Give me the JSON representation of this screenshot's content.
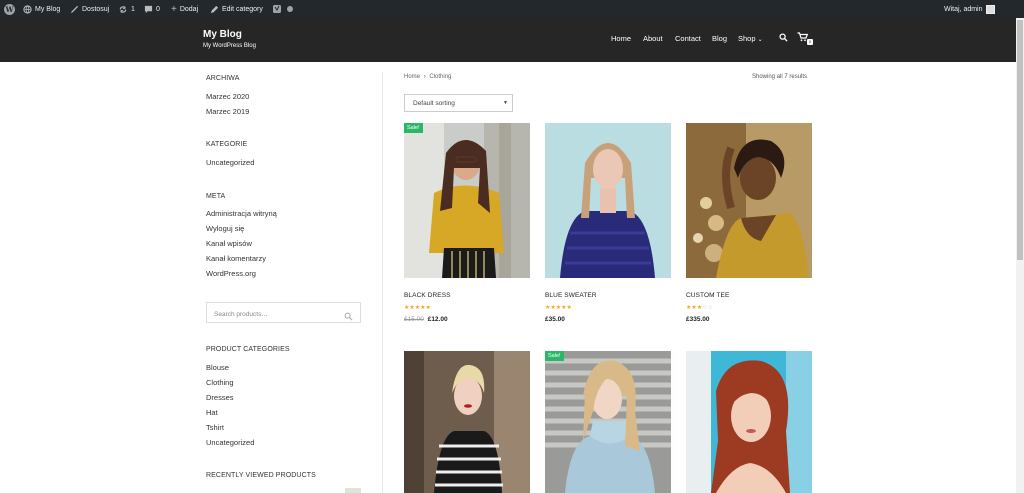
{
  "adminbar": {
    "site_name": "My Blog",
    "customize": "Dostosuj",
    "updates_count": "1",
    "comments_count": "0",
    "new_label": "Dodaj",
    "edit_label": "Edit category",
    "greeting": "Witaj, admin"
  },
  "header": {
    "title": "My Blog",
    "tagline": "My WordPress Blog",
    "nav": [
      "Home",
      "About",
      "Contact",
      "Blog",
      "Shop"
    ],
    "cart_count": "0"
  },
  "sidebar": {
    "archives_title": "ARCHIWA",
    "archives": [
      "Marzec 2020",
      "Marzec 2019"
    ],
    "categories_title": "KATEGORIE",
    "categories": [
      "Uncategorized"
    ],
    "meta_title": "META",
    "meta": [
      "Administracja witryną",
      "Wyloguj się",
      "Kanał wpisów",
      "Kanał komentarzy",
      "WordPress.org"
    ],
    "search_placeholder": "Search products…",
    "product_categories_title": "PRODUCT CATEGORIES",
    "product_categories": [
      "Blouse",
      "Clothing",
      "Dresses",
      "Hat",
      "Tshirt",
      "Uncategorized"
    ],
    "recently_viewed_title": "RECENTLY VIEWED PRODUCTS"
  },
  "main": {
    "breadcrumb_home": "Home",
    "breadcrumb_sep": "›",
    "breadcrumb_current": "Clothing",
    "results": "Showing all 7 results",
    "sorting": "Default sorting",
    "products": [
      {
        "name": "BLACK DRESS",
        "sale": "Sale!",
        "rating": 5,
        "old_price": "£15.00",
        "price": "£12.00"
      },
      {
        "name": "BLUE SWEATER",
        "sale": "",
        "rating": 5,
        "old_price": "",
        "price": "£35.00"
      },
      {
        "name": "CUSTOM TEE",
        "sale": "",
        "rating": 3,
        "old_price": "",
        "price": "£335.00"
      },
      {
        "name": "",
        "sale": "",
        "rating": 0,
        "old_price": "",
        "price": ""
      },
      {
        "name": "",
        "sale": "Sale!",
        "rating": 0,
        "old_price": "",
        "price": ""
      },
      {
        "name": "",
        "sale": "",
        "rating": 0,
        "old_price": "",
        "price": ""
      }
    ]
  },
  "colors": {
    "adminbar_bg": "#23282d",
    "header_bg": "#262626",
    "sale_badge": "#2ab868",
    "star": "#f5a623"
  }
}
